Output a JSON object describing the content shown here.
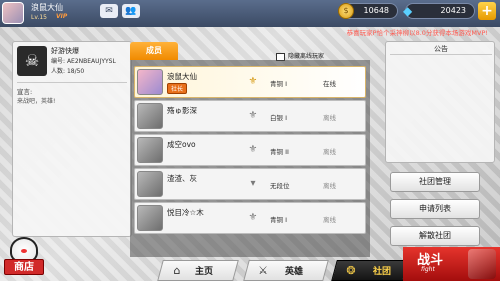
{
  "player": {
    "name": "浪鼠大仙",
    "level": "Lv.15",
    "vip": "VIP"
  },
  "icons": {
    "mail": "mail-icon",
    "friends": "friends-icon",
    "coin": "gold-coin-icon",
    "gem": "diamond-icon",
    "plus": "plus-icon"
  },
  "currency": {
    "gold": "10648",
    "diamonds": "20423",
    "plus_label": "+"
  },
  "ticker": "恭喜玩家P恰个采神柳以8.0分获得本场游戏MVP!",
  "club": {
    "name": "好游快爆",
    "id_label": "编号:",
    "id_value": "AE2NBEAUJYYSL",
    "members_label": "人数:",
    "members_value": "18/50",
    "declaration_label": "宣言:",
    "declaration_text": "来战吧，英雄!"
  },
  "shop_label": "商店",
  "members_tab": "成员",
  "hide_offline_label": "隐藏离线玩家",
  "members": [
    {
      "name": "浪鼠大仙",
      "role": "社长",
      "rank": "青铜 I",
      "status": "在线"
    },
    {
      "name": "殇ゅ影深",
      "role": "",
      "rank": "白银 I",
      "status": "离线"
    },
    {
      "name": "成空ovo",
      "role": "",
      "rank": "青铜 II",
      "status": "离线"
    },
    {
      "name": "渣渣、灰",
      "role": "",
      "rank": "无段位",
      "status": "离线"
    },
    {
      "name": "悦目冷☆木",
      "role": "",
      "rank": "青铜 I",
      "status": "离线"
    }
  ],
  "notice_title": "公告",
  "actions": {
    "manage": "社团管理",
    "applications": "申请列表",
    "disband": "解散社团"
  },
  "nav": {
    "home": "主页",
    "heroes": "英雄",
    "club": "社团",
    "battle": "战斗",
    "battle_sub": "fight"
  }
}
